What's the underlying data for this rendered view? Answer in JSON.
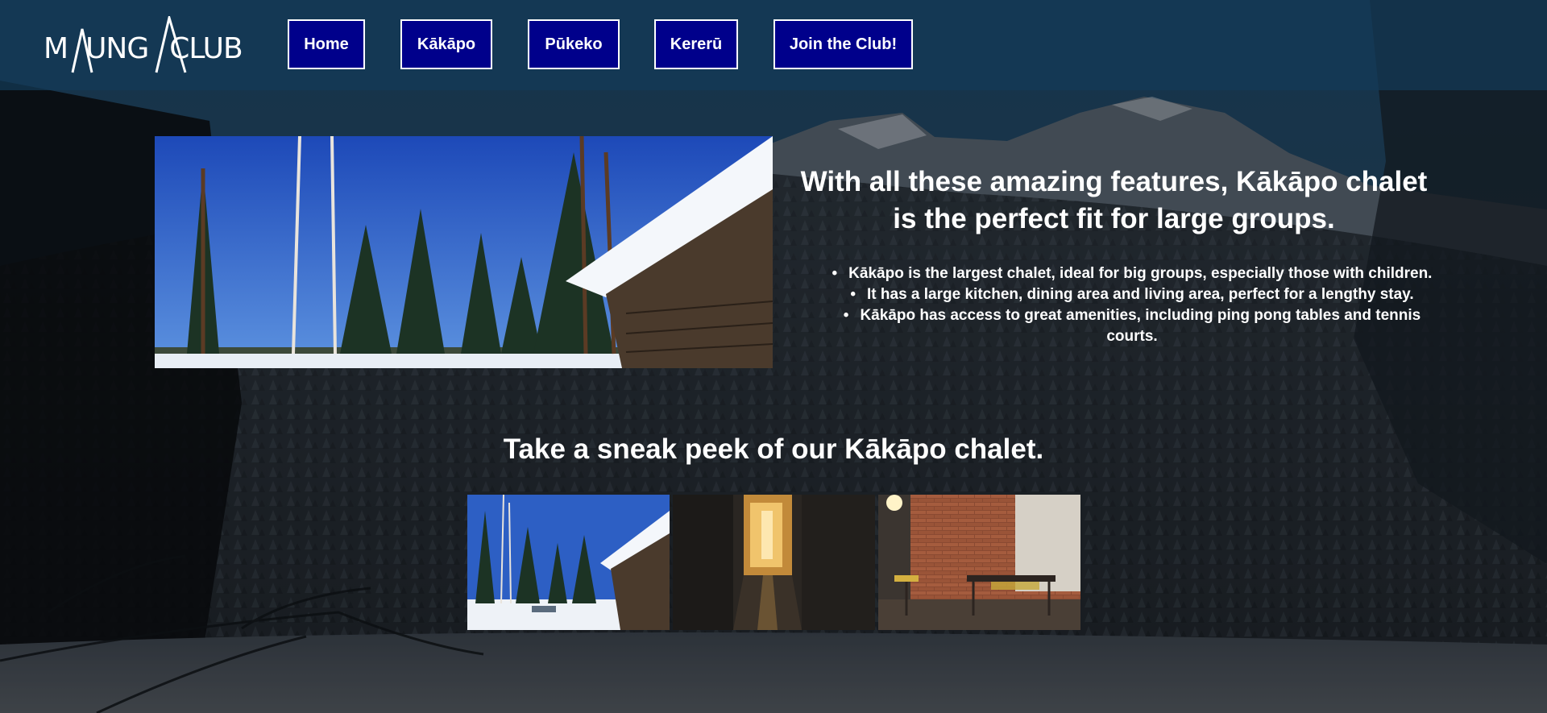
{
  "logo": {
    "text_before": "M",
    "text_middle": "UNG",
    "text_after": "CLUB",
    "alt": "Maunga Club"
  },
  "nav": {
    "items": [
      {
        "label": "Home"
      },
      {
        "label": "Kākāpo"
      },
      {
        "label": "Pūkeko"
      },
      {
        "label": "Kererū"
      },
      {
        "label": "Join the Club!"
      }
    ]
  },
  "feature": {
    "title": "With all these amazing features, Kākāpo chalet is the perfect fit for large groups.",
    "points": [
      "Kākāpo is the largest chalet, ideal for big groups, especially those with children.",
      "It has a large kitchen, dining area and living area, perfect for a lengthy stay.",
      "Kākāpo has access to great amenities, including ping pong tables and tennis courts."
    ]
  },
  "gallery": {
    "title": "Take a sneak peek of our Kākāpo chalet.",
    "thumbnails": [
      "snowy-cabin-photo",
      "hallway-photo",
      "kitchen-dining-photo"
    ]
  },
  "colors": {
    "header_bg": "#143a58",
    "nav_button_bg": "#00008b",
    "nav_button_border": "#ffffff",
    "text": "#ffffff",
    "page_bg": "#0d1217"
  }
}
